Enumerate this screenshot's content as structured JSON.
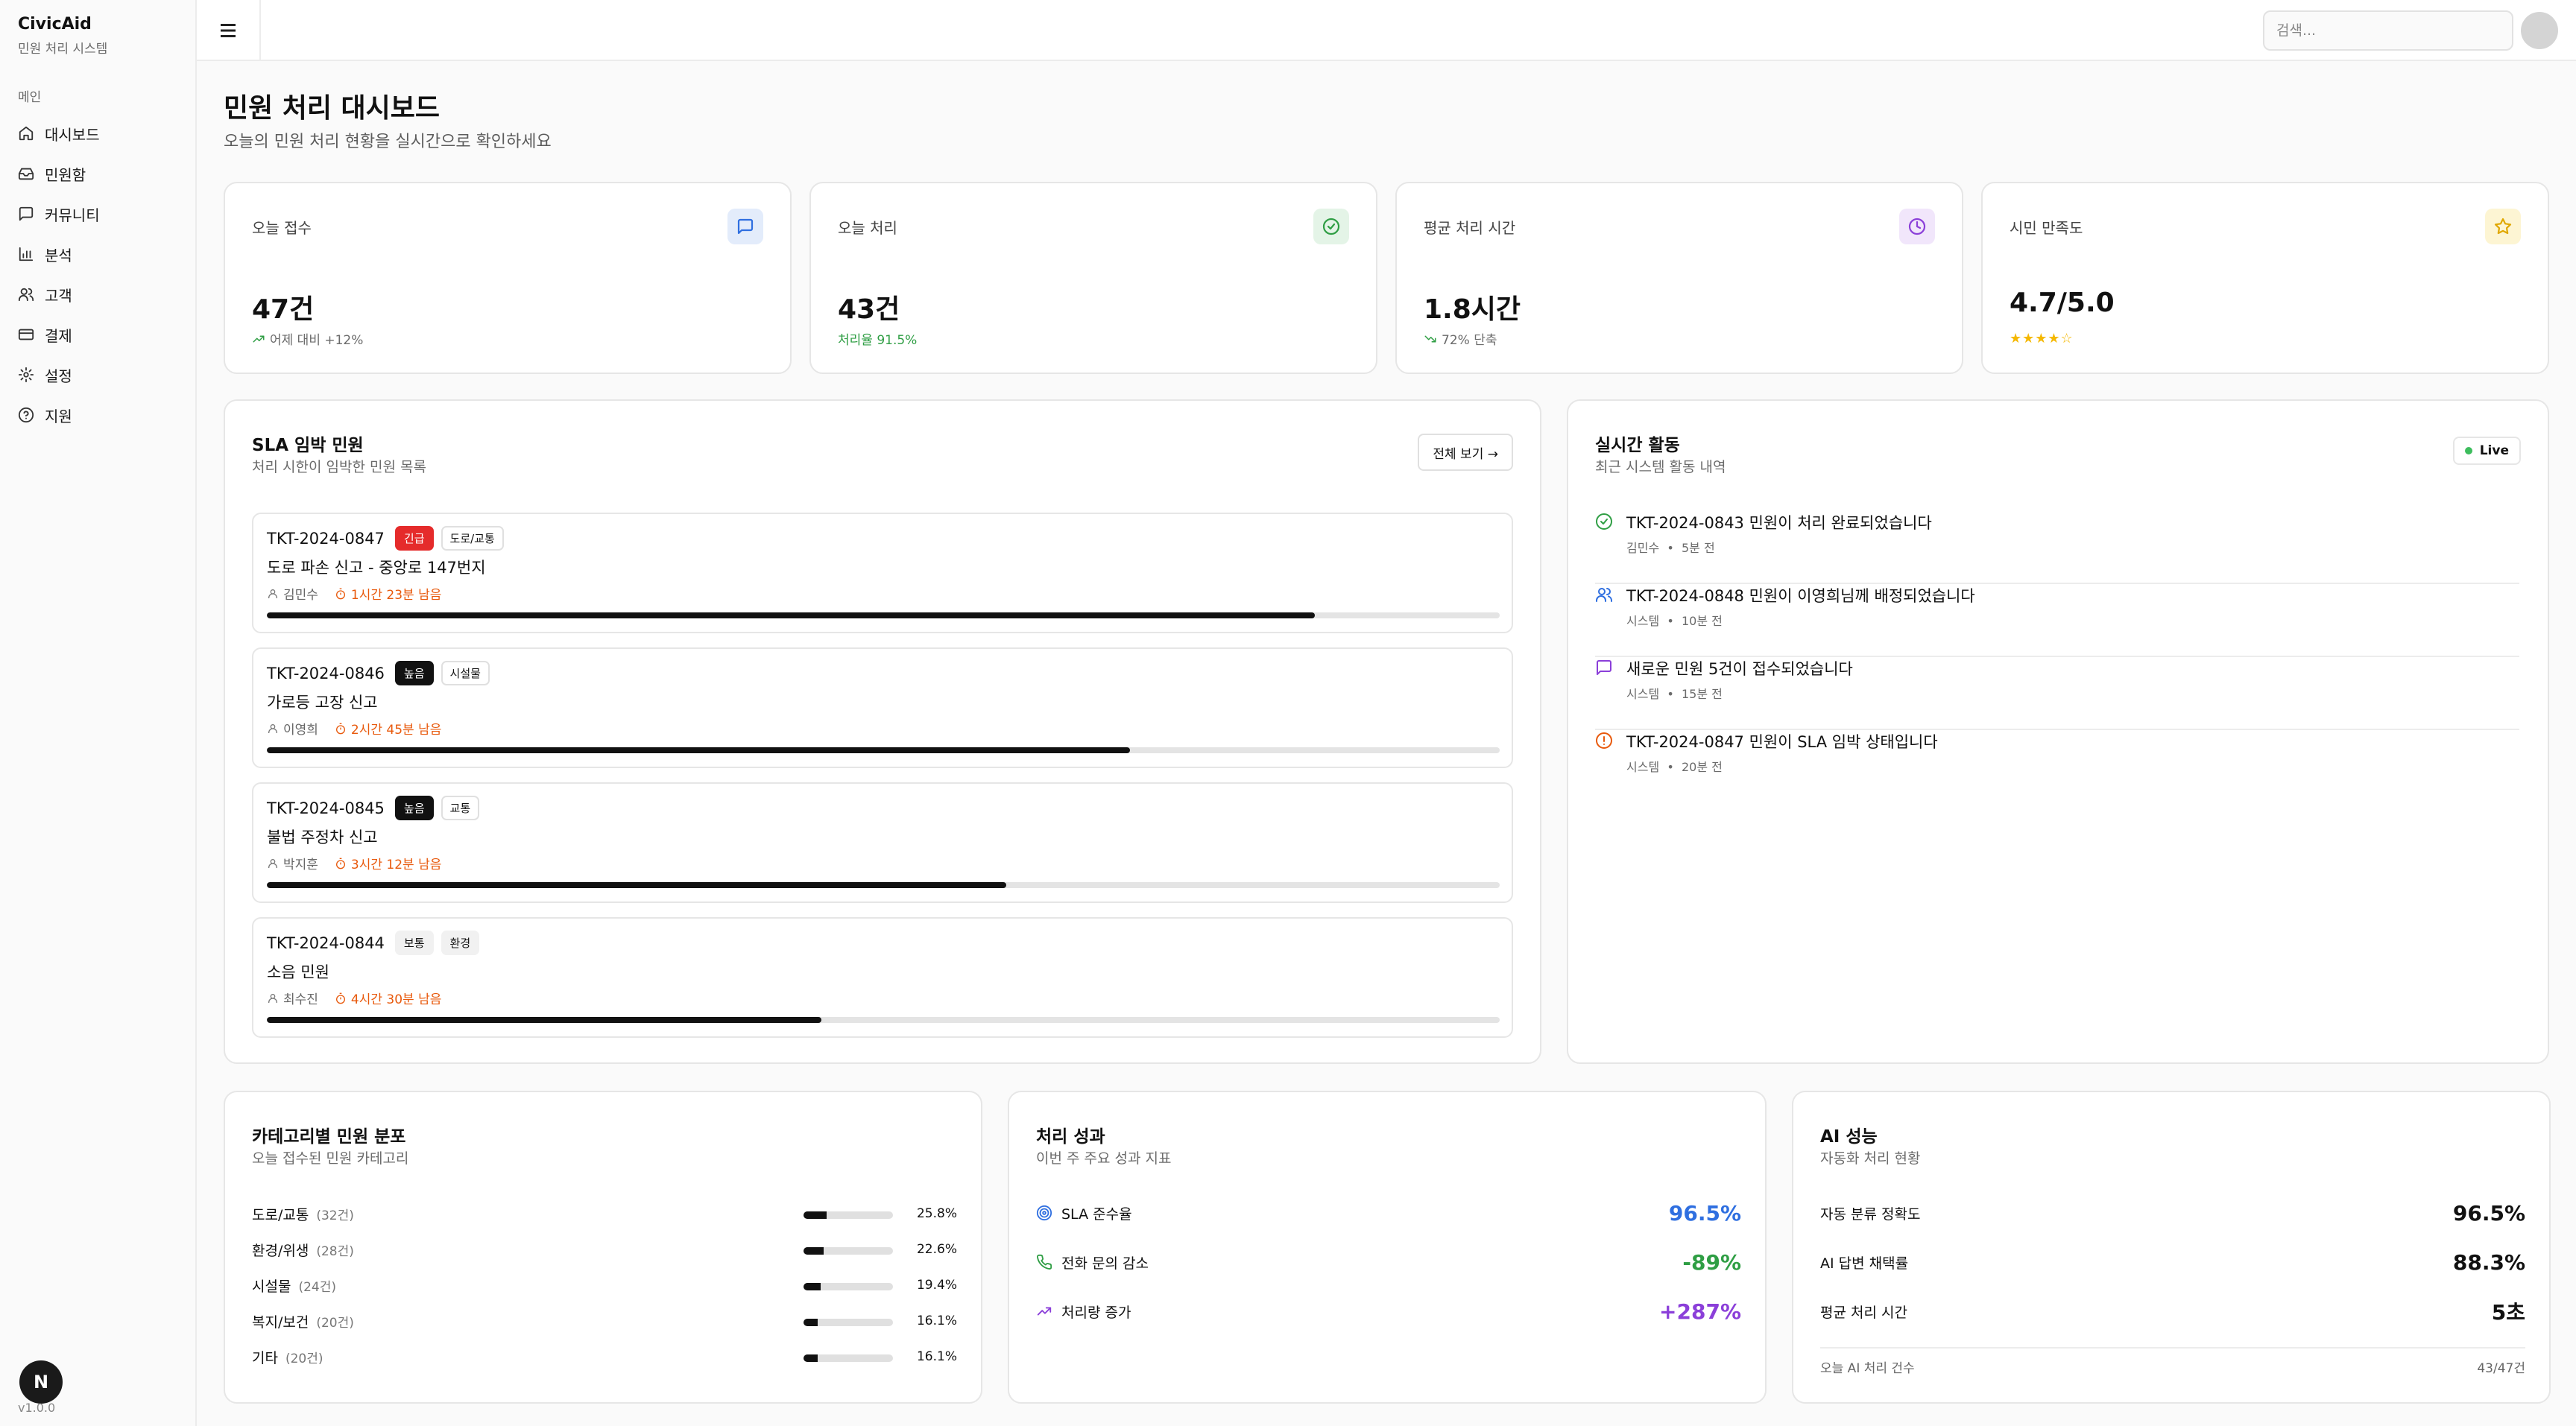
{
  "brand": {
    "title": "CivicAid",
    "subtitle": "민원 처리 시스템"
  },
  "sidebar": {
    "group_label": "메인",
    "items": [
      {
        "label": "대시보드",
        "icon": "home-icon"
      },
      {
        "label": "민원함",
        "icon": "inbox-icon"
      },
      {
        "label": "커뮤니티",
        "icon": "message-square-icon"
      },
      {
        "label": "분석",
        "icon": "bar-chart-icon"
      },
      {
        "label": "고객",
        "icon": "users-icon"
      },
      {
        "label": "결제",
        "icon": "credit-card-icon"
      },
      {
        "label": "설정",
        "icon": "gear-icon"
      },
      {
        "label": "지원",
        "icon": "help-circle-icon"
      }
    ],
    "badge": "N",
    "version": "v1.0.0"
  },
  "header": {
    "search_placeholder": "검색..."
  },
  "page": {
    "title": "민원 처리 대시보드",
    "subtitle": "오늘의 민원 처리 현황을 실시간으로 확인하세요"
  },
  "stats": [
    {
      "label": "오늘 접수",
      "value": "47건",
      "note": "어제 대비 +12%",
      "icon": "message-square-icon",
      "accent": "#2f6fe0"
    },
    {
      "label": "오늘 처리",
      "value": "43건",
      "note": "처리율 91.5%",
      "icon": "check-circle-icon",
      "accent": "#2f9e44"
    },
    {
      "label": "평균 처리 시간",
      "value": "1.8시간",
      "note": "72% 단축",
      "icon": "clock-icon",
      "accent": "#8b3fd9"
    },
    {
      "label": "시민 만족도",
      "value": "4.7/5.0",
      "stars": "★★★★☆",
      "rating": 4.7,
      "icon": "star-icon",
      "accent": "#e0a800"
    }
  ],
  "sla": {
    "title": "SLA 임박 민원",
    "subtitle": "처리 시한이 임박한 민원 목록",
    "view_all": "전체 보기 →",
    "tickets": [
      {
        "id": "TKT-2024-0847",
        "priority": "긴급",
        "priority_type": "urgent",
        "category": "도로/교통",
        "title": "도로 파손 신고 - 중앙로 147번지",
        "assignee": "김민수",
        "remaining": "1시간 23분 남음",
        "progress": 0.85
      },
      {
        "id": "TKT-2024-0846",
        "priority": "높음",
        "priority_type": "high",
        "category": "시설물",
        "title": "가로등 고장 신고",
        "assignee": "이영희",
        "remaining": "2시간 45분 남음",
        "progress": 0.7
      },
      {
        "id": "TKT-2024-0845",
        "priority": "높음",
        "priority_type": "high",
        "category": "교통",
        "title": "불법 주정차 신고",
        "assignee": "박지훈",
        "remaining": "3시간 12분 남음",
        "progress": 0.6
      },
      {
        "id": "TKT-2024-0844",
        "priority": "보통",
        "priority_type": "normal",
        "category": "환경",
        "title": "소음 민원",
        "assignee": "최수진",
        "remaining": "4시간 30분 남음",
        "progress": 0.45
      }
    ]
  },
  "activity": {
    "title": "실시간 활동",
    "subtitle": "최근 시스템 활동 내역",
    "live": "Live",
    "items": [
      {
        "text": "TKT-2024-0843 민원이 처리 완료되었습니다",
        "actor": "김민수",
        "time": "5분 전",
        "icon": "check-circle-icon",
        "color": "#2f9e44"
      },
      {
        "text": "TKT-2024-0848 민원이 이영희님께 배정되었습니다",
        "actor": "시스템",
        "time": "10분 전",
        "icon": "users-icon",
        "color": "#2f6fe0"
      },
      {
        "text": "새로운 민원 5건이 접수되었습니다",
        "actor": "시스템",
        "time": "15분 전",
        "icon": "message-square-icon",
        "color": "#8b3fd9"
      },
      {
        "text": "TKT-2024-0847 민원이 SLA 임박 상태입니다",
        "actor": "시스템",
        "time": "20분 전",
        "icon": "alert-circle-icon",
        "color": "#e8590c"
      }
    ]
  },
  "categories": {
    "title": "카테고리별 민원 분포",
    "subtitle": "오늘 접수된 민원 카테고리",
    "items": [
      {
        "name": "도로/교통",
        "count": "(32건)",
        "pct": "25.8%",
        "fraction": 0.258
      },
      {
        "name": "환경/위생",
        "count": "(28건)",
        "pct": "22.6%",
        "fraction": 0.226
      },
      {
        "name": "시설물",
        "count": "(24건)",
        "pct": "19.4%",
        "fraction": 0.194
      },
      {
        "name": "복지/보건",
        "count": "(20건)",
        "pct": "16.1%",
        "fraction": 0.161
      },
      {
        "name": "기타",
        "count": "(20건)",
        "pct": "16.1%",
        "fraction": 0.161
      }
    ]
  },
  "performance": {
    "title": "처리 성과",
    "subtitle": "이번 주 주요 성과 지표",
    "items": [
      {
        "label": "SLA 준수율",
        "value": "96.5%",
        "icon": "target-icon",
        "color": "#2f6fe0"
      },
      {
        "label": "전화 문의 감소",
        "value": "-89%",
        "icon": "phone-icon",
        "color": "#2f9e44"
      },
      {
        "label": "처리량 증가",
        "value": "+287%",
        "icon": "trending-up-icon",
        "color": "#8b3fd9"
      }
    ]
  },
  "ai": {
    "title": "AI 성능",
    "subtitle": "자동화 처리 현황",
    "items": [
      {
        "label": "자동 분류 정확도",
        "value": "96.5%"
      },
      {
        "label": "AI 답변 채택률",
        "value": "88.3%"
      },
      {
        "label": "평균 처리 시간",
        "value": "5초"
      }
    ],
    "footer_label": "오늘 AI 처리 건수",
    "footer_value": "43/47건"
  }
}
